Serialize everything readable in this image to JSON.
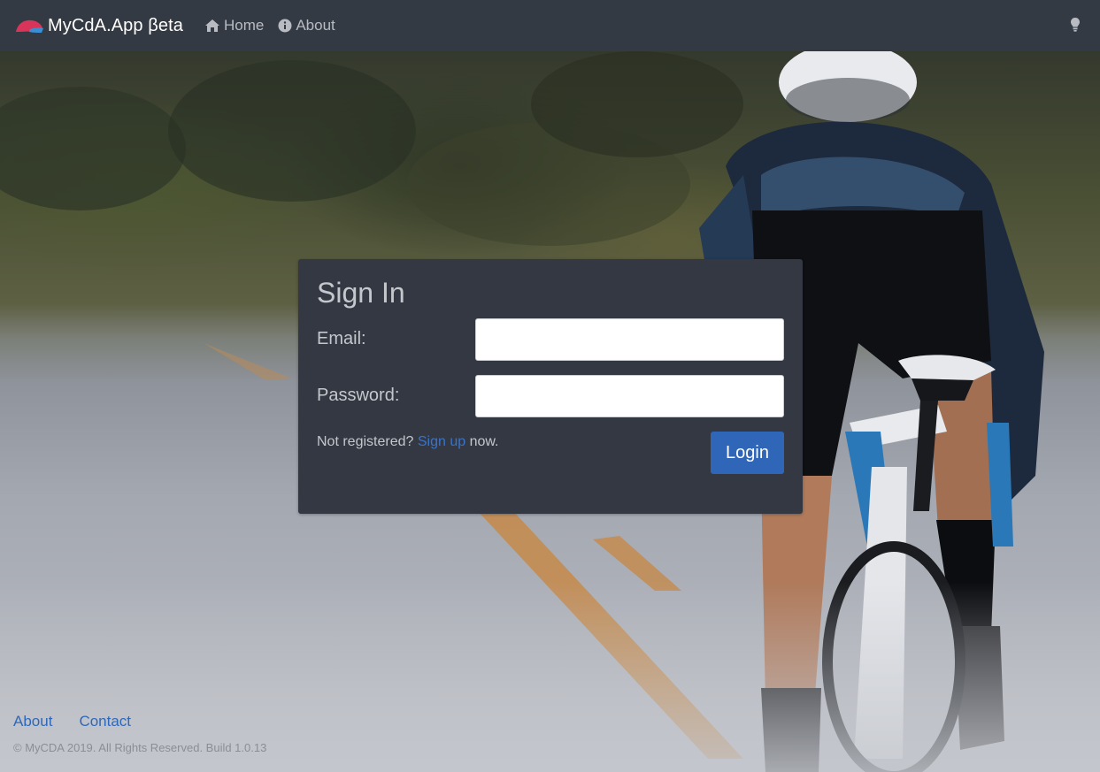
{
  "navbar": {
    "brand": "MyCdA.App βeta",
    "home_label": "Home",
    "about_label": "About",
    "home_icon": "home-icon",
    "about_icon": "info-icon",
    "theme_icon": "lightbulb-icon"
  },
  "signin": {
    "title": "Sign In",
    "email_label": "Email:",
    "email_value": "",
    "password_label": "Password:",
    "password_value": "",
    "not_registered": "Not registered?",
    "signup_link": "Sign up",
    "now": "now.",
    "login_button": "Login"
  },
  "footer": {
    "links": [
      "About",
      "Contact"
    ],
    "copyright": "© MyCDA 2019. All Rights Reserved. Build 1.0.13"
  },
  "colors": {
    "navbar_bg": "#343a44",
    "card_bg": "#333842",
    "primary": "#2f66b7",
    "link": "#3a73c9"
  }
}
